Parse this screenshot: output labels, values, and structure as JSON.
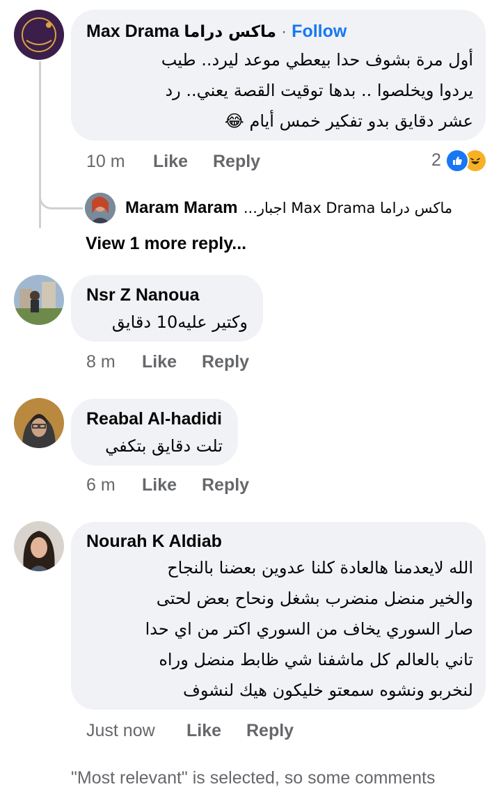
{
  "comments": [
    {
      "author": "Max Drama",
      "author_alt": "ماكس دراما",
      "follow_label": "Follow",
      "separator": "·",
      "text_lines": [
        "أول مرة بشوف حدا بيعطي موعد ليرد.. طيب",
        "يردوا ويخلصوا .. بدها توقيت القصة يعني.. رد",
        "عشر دقايق بدو تفكير خمس أيام 😂"
      ],
      "time": "10 m",
      "like_label": "Like",
      "reply_label": "Reply",
      "reaction_count": "2",
      "reply_preview": {
        "author": "Maram Maram",
        "text": "ماكس دراما Max Drama اجبار..."
      },
      "view_more_label": "View 1 more reply..."
    },
    {
      "author": "Nsr Z Nanoua",
      "text_lines": [
        "وكتير عليه10 دقايق"
      ],
      "time": "8 m",
      "like_label": "Like",
      "reply_label": "Reply"
    },
    {
      "author": "Reabal Al-hadidi",
      "text_lines": [
        "تلت دقايق بتكفي"
      ],
      "time": "6 m",
      "like_label": "Like",
      "reply_label": "Reply"
    },
    {
      "author": "Nourah K Aldiab",
      "text_lines": [
        "الله لايعدمنا هالعادة كلنا عدوين بعضنا بالنجاح",
        "والخير منضل منضرب بشغل ونحاح بعض لحتى",
        "صار السوري يخاف من السوري اكتر من اي حدا",
        "تاني  بالعالم كل ماشفنا شي ظابط منضل وراه",
        "لنخربو ونشوه سمعتو خليكون هيك لنشوف"
      ],
      "time": "Just now",
      "like_label": "Like",
      "reply_label": "Reply"
    }
  ],
  "footer": {
    "note": "\"Most relevant\" is selected, so some comments"
  },
  "colors": {
    "bubble": "#f0f2f5",
    "secondary_text": "#65676b",
    "follow_blue": "#1877f2",
    "like_blue": "#1877f2",
    "haha_yellow": "#f7b125"
  },
  "icons": {
    "like_reaction": "thumbs-up-icon",
    "haha_reaction": "laughing-face-icon"
  }
}
